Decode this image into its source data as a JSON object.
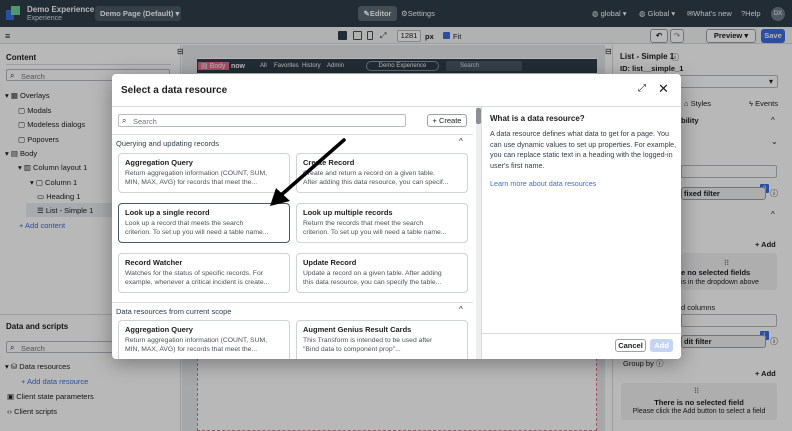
{
  "app": {
    "title": "Demo Experience",
    "subtitle": "Experience",
    "page_selector": "Demo Page (Default)",
    "editor_label": "Editor",
    "settings_label": "Settings",
    "scope": "global",
    "language": "Global",
    "whats_new": "What's new",
    "help": "Help",
    "user": "DX"
  },
  "toolbar": {
    "width_value": "1281",
    "width_unit": "px",
    "fit_label": "Fit",
    "preview_label": "Preview",
    "save_label": "Save"
  },
  "left": {
    "content_title": "Content",
    "search_placeholder": "Search",
    "tree": [
      "Overlays",
      "Modals",
      "Modeless dialogs",
      "Popovers",
      "Body",
      "Column layout 1",
      "Column 1",
      "Heading 1",
      "List - Simple 1"
    ],
    "add_content": "+ Add content",
    "data_title": "Data and scripts",
    "data_search_placeholder": "Search",
    "data_items": [
      "Data resources",
      "+ Add data resource",
      "Client state parameters",
      "Client scripts"
    ]
  },
  "canvas": {
    "body_tag": "Body",
    "mini_brand": "now",
    "mini_nav": [
      "All",
      "Favorites",
      "History",
      "Admin"
    ],
    "mini_exp": "Demo Experience",
    "mini_search": "Search"
  },
  "right": {
    "title": "List - Simple 1",
    "id_label": "ID: list__simple_1",
    "tabs": [
      "Styles",
      "Events"
    ],
    "visibility": "bility",
    "fixed_filter": "fixed filter",
    "badge0": "0",
    "add1": "+ Add",
    "no_fields_1": "e no selected fields",
    "no_fields_2": "is in the dropdown above",
    "columns": "d columns",
    "badge1": "1",
    "edit_filter": "dit filter",
    "group_by": "Group by",
    "add2": "+ Add",
    "no_field_title": "There is no selected field",
    "no_field_desc": "Please click the Add button to select a field"
  },
  "modal": {
    "title": "Select a data resource",
    "search_placeholder": "Search",
    "create_label": "+ Create",
    "group1": "Querying and updating records",
    "group2": "Data resources from current scope",
    "cards": [
      {
        "title": "Aggregation Query",
        "desc1": "Return aggregation information (COUNT, SUM,",
        "desc2": "MIN, MAX, AVG) for records that meet the..."
      },
      {
        "title": "Create Record",
        "desc1": "Create and return a record on a given table.",
        "desc2": "After adding this data resource, you can specif..."
      },
      {
        "title": "Look up a single record",
        "desc1": "Look up a record that meets the search",
        "desc2": "criterion. To set up you will need a table name..."
      },
      {
        "title": "Look up multiple records",
        "desc1": "Return the records that meet the search",
        "desc2": "criterion. To set up you will need a table name..."
      },
      {
        "title": "Record Watcher",
        "desc1": "Watches for the status of specific records. For",
        "desc2": "example, whenever a critical incident is create..."
      },
      {
        "title": "Update Record",
        "desc1": "Update a record on a given table. After adding",
        "desc2": "this data resource, you can specify the table..."
      },
      {
        "title": "Aggregation Query",
        "desc1": "Return aggregation information (COUNT, SUM,",
        "desc2": "MIN, MAX, AVG) for records that meet the..."
      },
      {
        "title": "Augment Genius Result Cards",
        "desc1": "This Transform is intended to be used after",
        "desc2": "\"Bind data to component prop\"..."
      }
    ],
    "info_title": "What is a data resource?",
    "info_text": [
      "A data resource defines what data to get for a page. You",
      "can use dynamic values to set up properties. For example,",
      "you can replace static text in a heading with the logged-in",
      "user's first name."
    ],
    "info_link": "Learn more about data resources",
    "cancel_label": "Cancel",
    "add_label": "Add"
  }
}
